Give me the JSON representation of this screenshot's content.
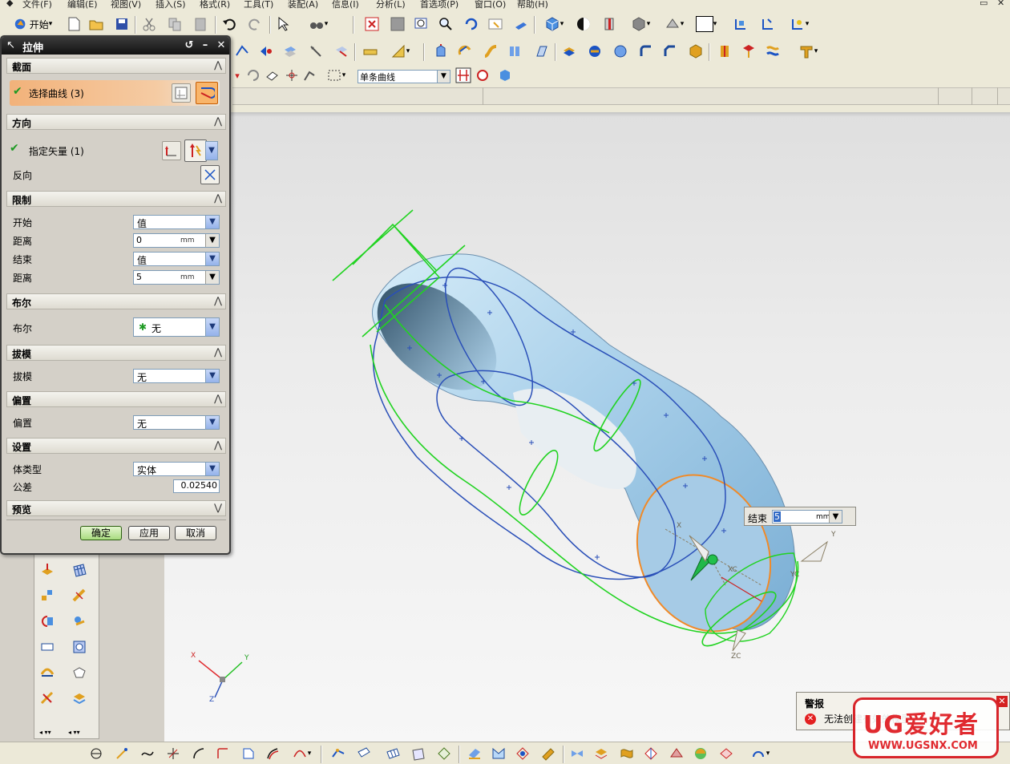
{
  "menu": {
    "items": [
      "文件(F)",
      "编辑(E)",
      "视图(V)",
      "插入(S)",
      "格式(R)",
      "工具(T)",
      "装配(A)",
      "信息(I)",
      "分析(L)",
      "首选项(P)",
      "窗口(O)",
      "帮助(H)"
    ]
  },
  "toolbar": {
    "start_label": "开始",
    "filter_value": "单条曲线"
  },
  "dialog": {
    "title": "拉伸",
    "sections": {
      "section": "截面",
      "direction": "方向",
      "limits": "限制",
      "boolean": "布尔",
      "draft": "拔模",
      "offset": "偏置",
      "settings": "设置",
      "preview": "预览"
    },
    "select_curve": "选择曲线 (3)",
    "specify_vector": "指定矢量 (1)",
    "reverse": "反向",
    "start_label": "开始",
    "start_value": "值",
    "distance_label": "距离",
    "start_distance": "0",
    "end_label": "结束",
    "end_value": "值",
    "end_distance": "5",
    "unit": "mm",
    "boolean_label": "布尔",
    "boolean_value": "无",
    "draft_label": "拔模",
    "draft_value": "无",
    "offset_label": "偏置",
    "offset_value": "无",
    "body_type_label": "体类型",
    "body_type_value": "实体",
    "tolerance_label": "公差",
    "tolerance_value": "0.02540",
    "ok": "确定",
    "apply": "应用",
    "cancel": "取消"
  },
  "viewport": {
    "end_label": "结束",
    "end_value": "5",
    "unit": "mm",
    "axis_x": "X",
    "axis_y": "Y",
    "axis_z": "Z",
    "handle_x": "X",
    "handle_y": "Y",
    "handle_xc": "XC",
    "handle_yc": "YC",
    "handle_zc": "ZC"
  },
  "warning": {
    "title": "警报",
    "message": "无法创建有效的模型",
    "close": "✕"
  },
  "watermark": {
    "line1": "UG爱好者",
    "line2": "WWW.UGSNX.COM"
  },
  "colors": {
    "accent_green": "#21d321",
    "curve_blue": "#2a4fb8",
    "end_orange": "#f08a28",
    "surface": "#a8cde6"
  }
}
